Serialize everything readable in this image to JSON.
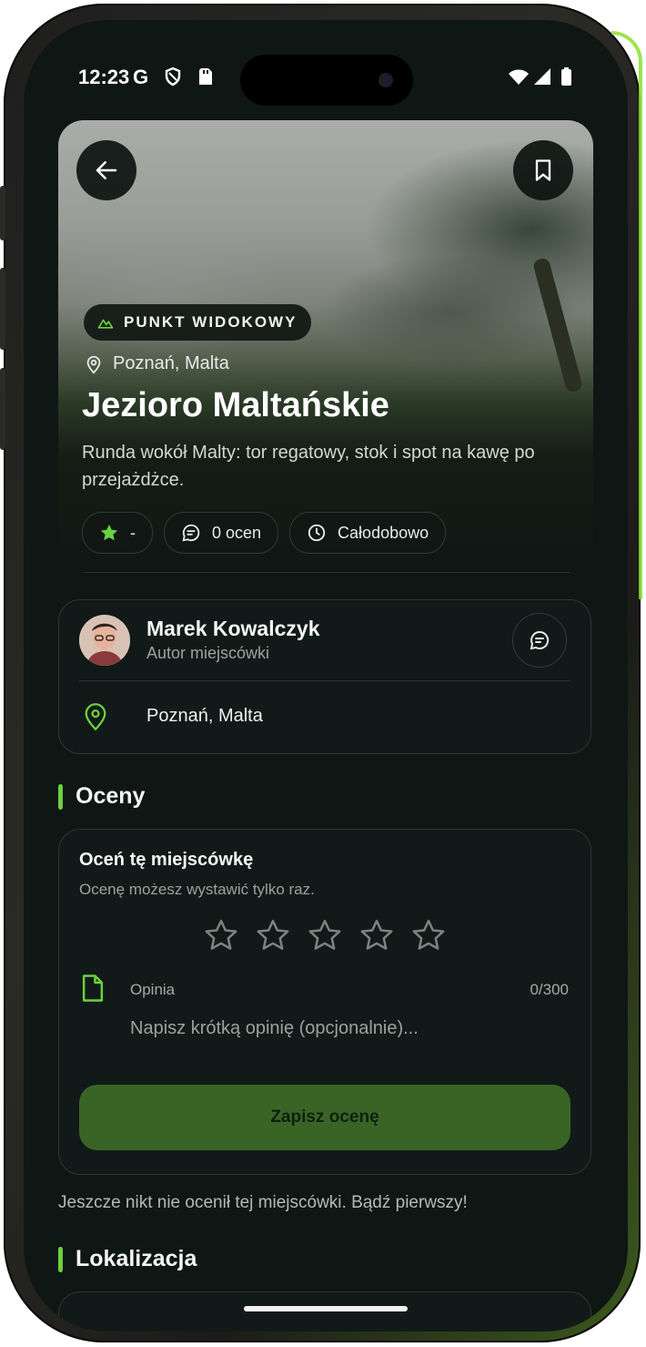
{
  "status_bar": {
    "time": "12:23"
  },
  "hero": {
    "category_badge": "PUNKT WIDOKOWY",
    "location": "Poznań, Malta",
    "title": "Jezioro Maltańskie",
    "description": "Runda wokół Malty: tor regatowy, stok i spot na kawę po przejażdżce.",
    "chips": {
      "rating": "-",
      "reviews": "0 ocen",
      "hours": "Całodobowo"
    }
  },
  "author": {
    "name": "Marek Kowalczyk",
    "role": "Autor miejscówki",
    "location": "Poznań, Malta"
  },
  "ratings_section": {
    "heading": "Oceny",
    "title": "Oceń tę miejscówkę",
    "subtitle": "Ocenę możesz wystawić tylko raz.",
    "opinion_label": "Opinia",
    "opinion_counter": "0/300",
    "opinion_placeholder": "Napisz krótką opinię (opcjonalnie)...",
    "opinion_value": "",
    "save_label": "Zapisz ocenę",
    "empty_note": "Jeszcze nikt nie ocenił tej miejscówki. Bądź pierwszy!"
  },
  "location_section": {
    "heading": "Lokalizacja"
  },
  "colors": {
    "accent": "#6bd13e",
    "background": "#0f1715",
    "save_button": "#3a6426"
  }
}
